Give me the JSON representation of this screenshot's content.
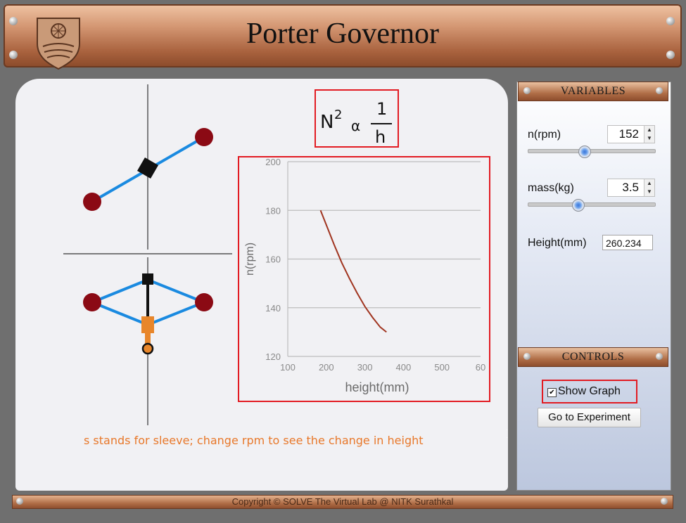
{
  "header": {
    "title": "Porter Governor"
  },
  "formula": {
    "lhs": "N",
    "exp": "2",
    "rel": "α",
    "num": "1",
    "den": "h"
  },
  "graph": {
    "ylabel": "n(rpm)",
    "xlabel": "height(mm)",
    "yticks": [
      "120",
      "140",
      "160",
      "180",
      "200"
    ],
    "xticks": [
      "100",
      "200",
      "300",
      "400",
      "500",
      "60"
    ]
  },
  "chart_data": {
    "type": "line",
    "xlabel": "height(mm)",
    "ylabel": "n(rpm)",
    "xlim": [
      100,
      600
    ],
    "ylim": [
      120,
      200
    ],
    "grid": true,
    "series": [
      {
        "x": [
          185,
          200,
          220,
          240,
          260,
          280,
          300,
          320,
          340,
          356
        ],
        "y": [
          180,
          174,
          166,
          158.5,
          152,
          146,
          140.5,
          136,
          132,
          130
        ]
      }
    ]
  },
  "note": "s stands for sleeve; change rpm to see the change in height",
  "variables": {
    "title": "VARIABLES",
    "rpm_label": "n(rpm)",
    "rpm_value": "152",
    "rpm_fraction": 0.4,
    "mass_label": "mass(kg)",
    "mass_value": "3.5",
    "mass_fraction": 0.35,
    "height_label": "Height(mm)",
    "height_value": "260.234"
  },
  "controls": {
    "title": "CONTROLS",
    "show_graph_label": "Show Graph",
    "show_graph_checked": true,
    "go_label": "Go to Experiment"
  },
  "footer": {
    "text": "Copyright © SOLVE The Virtual Lab @ NITK Surathkal"
  },
  "colors": {
    "accent_red": "#e21b22",
    "ball": "#8b0a14",
    "arm": "#1a8ae0",
    "sleeve": "#e8862a",
    "curve": "#a0341f",
    "note": "#e8782a"
  }
}
